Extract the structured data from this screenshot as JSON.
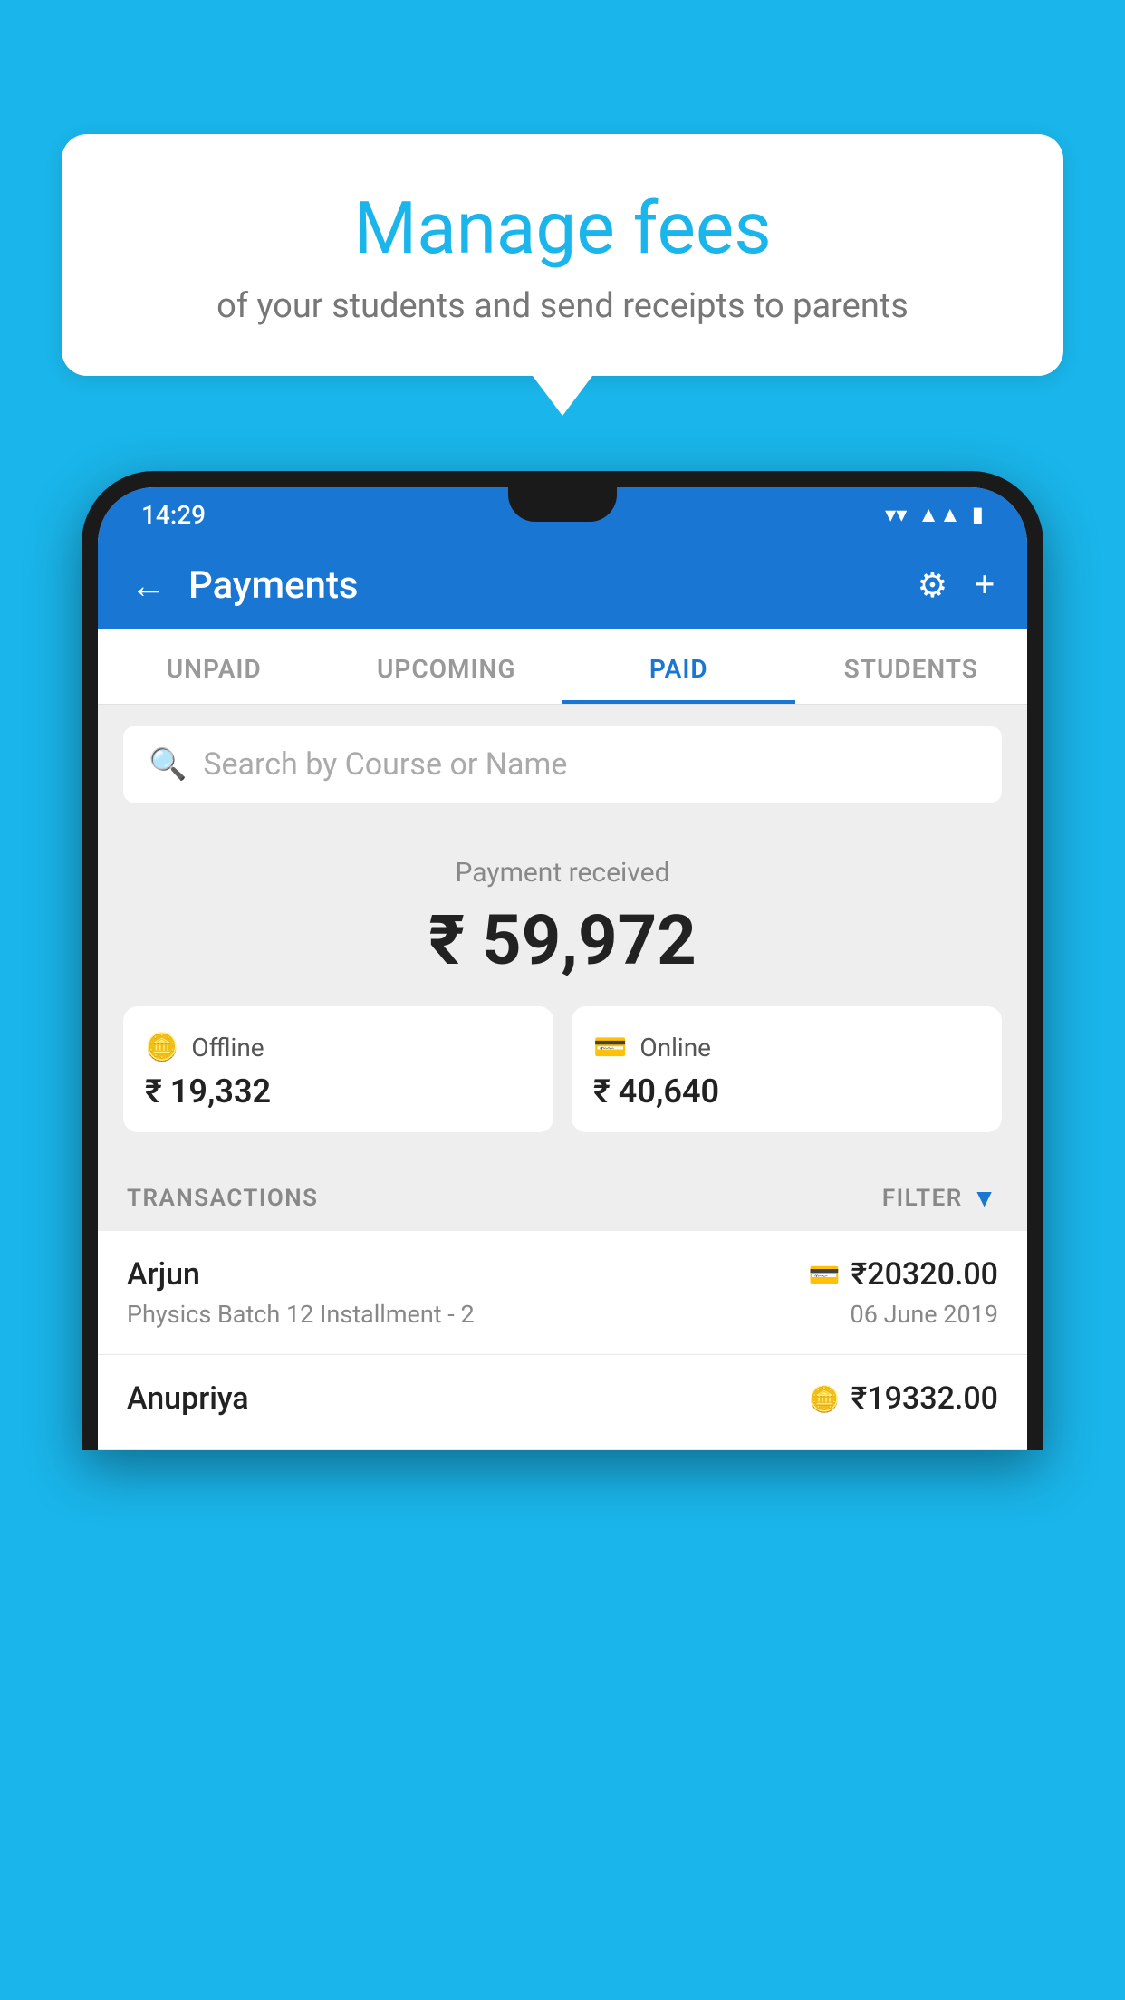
{
  "background_color": "#1ab5ea",
  "tooltip": {
    "title": "Manage fees",
    "subtitle": "of your students and send receipts to parents"
  },
  "phone": {
    "status_bar": {
      "time": "14:29",
      "icons": [
        "wifi",
        "signal",
        "battery"
      ]
    },
    "header": {
      "back_label": "←",
      "title": "Payments",
      "gear_icon": "⚙",
      "plus_icon": "+"
    },
    "tabs": [
      {
        "label": "UNPAID",
        "active": false
      },
      {
        "label": "UPCOMING",
        "active": false
      },
      {
        "label": "PAID",
        "active": true
      },
      {
        "label": "STUDENTS",
        "active": false
      }
    ],
    "search": {
      "placeholder": "Search by Course or Name"
    },
    "payment_summary": {
      "label": "Payment received",
      "amount": "₹ 59,972",
      "offline": {
        "icon": "💳",
        "label": "Offline",
        "amount": "₹ 19,332"
      },
      "online": {
        "icon": "💳",
        "label": "Online",
        "amount": "₹ 40,640"
      }
    },
    "transactions": {
      "header_label": "TRANSACTIONS",
      "filter_label": "FILTER",
      "items": [
        {
          "name": "Arjun",
          "course": "Physics Batch 12 Installment - 2",
          "amount": "₹20320.00",
          "date": "06 June 2019",
          "payment_type": "online"
        },
        {
          "name": "Anupriya",
          "course": "",
          "amount": "₹19332.00",
          "date": "",
          "payment_type": "offline"
        }
      ]
    }
  }
}
